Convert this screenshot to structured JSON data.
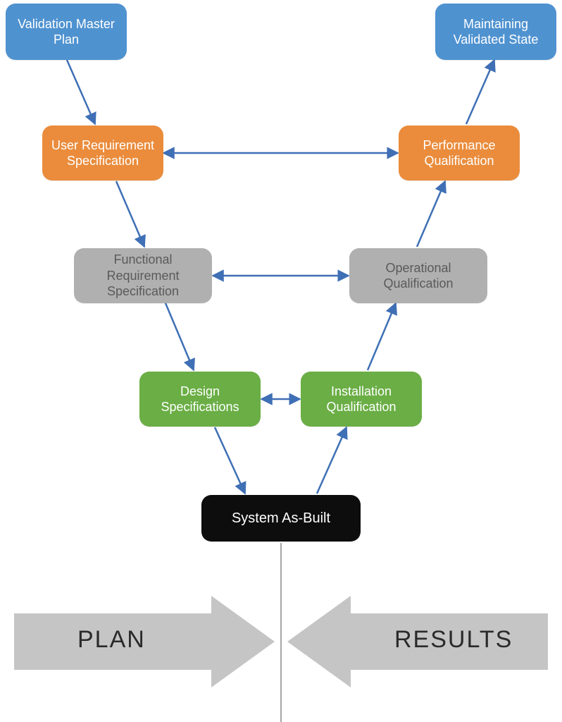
{
  "nodes": {
    "vmp": {
      "label": "Validation Master Plan"
    },
    "mvs": {
      "label": "Maintaining Validated State"
    },
    "urs": {
      "label": "User Requirement Specification"
    },
    "pq": {
      "label": "Performance Qualification"
    },
    "frs": {
      "label": "Functional Requirement Specification"
    },
    "oq": {
      "label": "Operational Qualification"
    },
    "ds": {
      "label": "Design Specifications"
    },
    "iq": {
      "label": "Installation Qualification"
    },
    "sab": {
      "label": "System As-Built"
    }
  },
  "footer": {
    "plan": "PLAN",
    "results": "RESULTS"
  },
  "colors": {
    "blue": "#4F92D0",
    "orange": "#EA8C3C",
    "gray": "#B0B0B0",
    "green": "#6AAE45",
    "black": "#0d0d0d",
    "arrow": "#3F6FB5",
    "footerArrow": "#C5C5C5"
  },
  "chart_data": {
    "type": "diagram",
    "title": "Validation V‑Model",
    "left_branch": [
      "Validation Master Plan",
      "User Requirement Specification",
      "Functional Requirement Specification",
      "Design Specifications"
    ],
    "right_branch": [
      "Maintaining Validated State",
      "Performance Qualification",
      "Operational Qualification",
      "Installation Qualification"
    ],
    "apex": "System As-Built",
    "horizontal_pairs": [
      [
        "User Requirement Specification",
        "Performance Qualification"
      ],
      [
        "Functional Requirement Specification",
        "Operational Qualification"
      ],
      [
        "Design Specifications",
        "Installation Qualification"
      ]
    ],
    "left_label": "PLAN",
    "right_label": "RESULTS"
  }
}
